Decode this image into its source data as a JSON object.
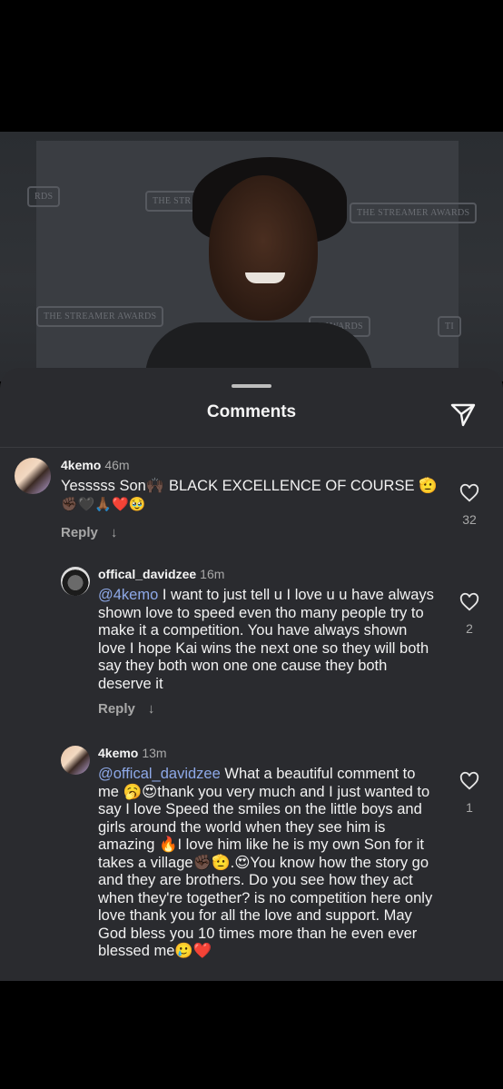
{
  "photo": {
    "logos": [
      "RDS",
      "THE STR",
      "THE STREAMER AWARDS",
      "THE STREAMER AWARDS",
      "E AWARDS",
      "TI"
    ]
  },
  "sheet": {
    "title": "Comments",
    "share_icon": "send-icon"
  },
  "comments": [
    {
      "user": "4kemo",
      "time": "46m",
      "text_line1": "Yesssss Son🙌🏿 BLACK EXCELLENCE OF COURSE 🫡",
      "text_line2": "✊🏿🖤🙏🏾❤️🥹",
      "reply_label": "Reply",
      "likes": "32"
    },
    {
      "user": "offical_davidzee",
      "time": "16m",
      "mention": "@4kemo",
      "text": "I want to just tell u I love u u have always shown love to speed even tho many people try to make it a competition. You have always shown love I hope Kai wins the next one so they will both say they both won one one cause they both deserve it",
      "reply_label": "Reply",
      "likes": "2"
    },
    {
      "user": "4kemo",
      "time": "13m",
      "mention": "@offical_davidzee",
      "text": "What a beautiful comment to me 🥱😍thank you very much and I just wanted to say I love Speed the smiles on the little boys and girls around the world when they see him is amazing 🔥I love him like he is my own Son for it takes a village✊🏿🫡.😍You know how the story go and they are brothers. Do you see how they act when they're together? is no competition here only love thank you for all the love and support. May God bless you 10 times more than he even ever blessed me🥲❤️",
      "likes": "1"
    }
  ]
}
